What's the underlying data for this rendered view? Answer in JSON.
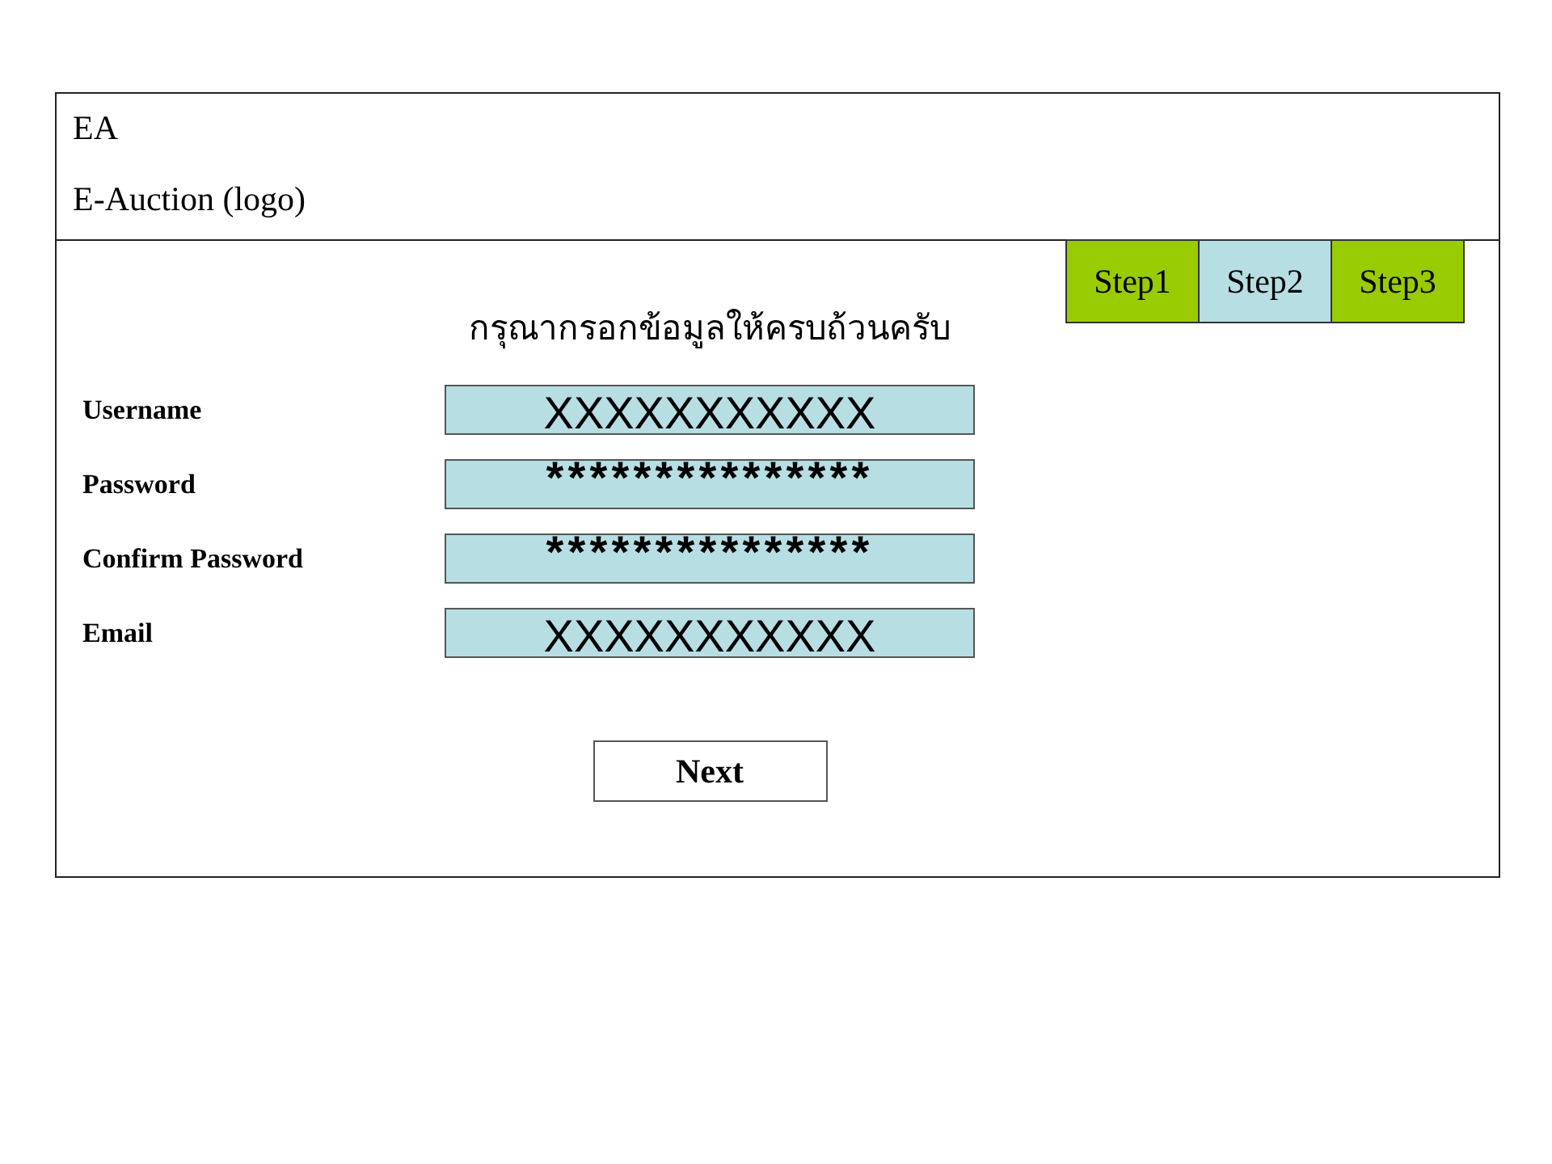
{
  "header": {
    "title": "EA",
    "logo": "E-Auction (logo)"
  },
  "steps": [
    {
      "label": "Step1",
      "selected": false
    },
    {
      "label": "Step2",
      "selected": true
    },
    {
      "label": "Step3",
      "selected": false
    }
  ],
  "heading": "กรุณากรอกข้อมูลให้ครบถ้วนครับ",
  "fields": [
    {
      "label": "Username",
      "value": "XXXXXXXXXXX",
      "kind": "text"
    },
    {
      "label": "Password",
      "value": "***************",
      "kind": "password"
    },
    {
      "label": "Confirm Password",
      "value": "***************",
      "kind": "password"
    },
    {
      "label": "Email",
      "value": "XXXXXXXXXXX",
      "kind": "text"
    }
  ],
  "buttons": [
    "Next"
  ]
}
